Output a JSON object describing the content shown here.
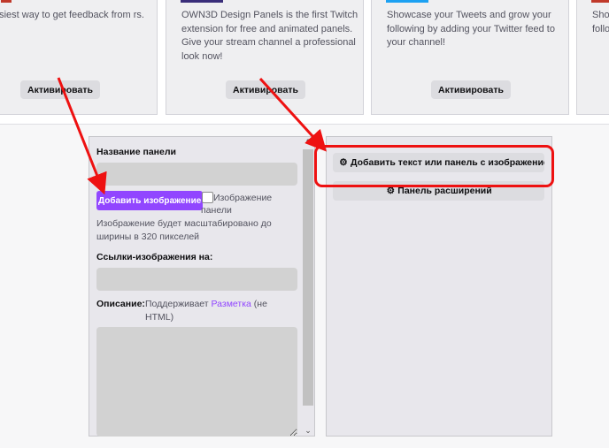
{
  "extension_cards": [
    {
      "description": "asiest way to get feedback from rs.",
      "button": "Активировать"
    },
    {
      "description": "OWN3D Design Panels is the first Twitch extension for free and animated panels. Give your stream channel a professional look now!",
      "button": "Активировать"
    },
    {
      "description": "Showcase your Tweets and grow your following by adding your Twitter feed to your channel!",
      "button": "Активировать"
    },
    {
      "description": "Show follo"
    }
  ],
  "panel_editor": {
    "title_label": "Название панели",
    "title_value": "",
    "upload_button": "Добавить изображение",
    "panel_image_checkbox_label": "Изображение панели",
    "scale_note": "Изображение будет масштабировано до ширины в 320 пикселей",
    "link_label": "Ссылки-изображения на:",
    "link_value": "",
    "description_label": "Описание:",
    "description_supports": "Поддерживает",
    "description_link": "Разметка",
    "description_suffix": "(не HTML)",
    "description_value": ""
  },
  "add_panel_menu": {
    "add_text_or_image": "Добавить текст или панель с изображением",
    "extension_panel": "Панель расширений"
  },
  "colors": {
    "accent": "#9146ff",
    "annotation": "#ee1111"
  }
}
